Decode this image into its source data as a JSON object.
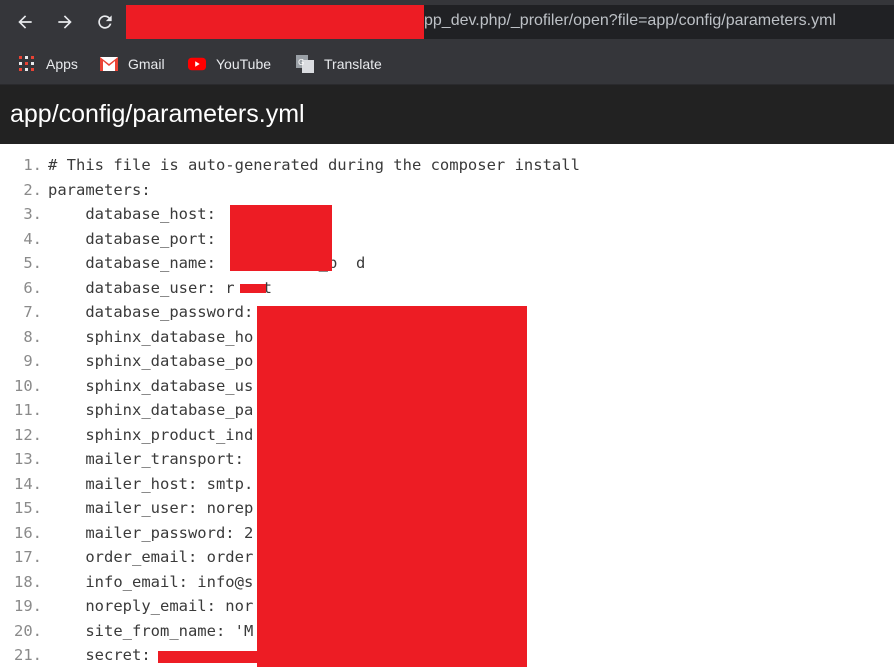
{
  "browser": {
    "url_visible": "pp_dev.php/_profiler/open?file=app/config/parameters.yml",
    "bookmarks": [
      {
        "label": "Apps",
        "icon": "apps-grid-icon"
      },
      {
        "label": "Gmail",
        "icon": "gmail-icon"
      },
      {
        "label": "YouTube",
        "icon": "youtube-icon"
      },
      {
        "label": "Translate",
        "icon": "translate-icon"
      }
    ]
  },
  "page": {
    "title": "app/config/parameters.yml"
  },
  "code_lines": [
    {
      "n": "1.",
      "text": "# This file is auto-generated during the composer install"
    },
    {
      "n": "2.",
      "text": "parameters:"
    },
    {
      "n": "3.",
      "text": "    database_host:"
    },
    {
      "n": "4.",
      "text": "    database_port:"
    },
    {
      "n": "5.",
      "text": "    database_name:           _p  d"
    },
    {
      "n": "6.",
      "text": "    database_user: r   t"
    },
    {
      "n": "7.",
      "text": "    database_password:"
    },
    {
      "n": "8.",
      "text": "    sphinx_database_ho"
    },
    {
      "n": "9.",
      "text": "    sphinx_database_po"
    },
    {
      "n": "10.",
      "text": "    sphinx_database_us"
    },
    {
      "n": "11.",
      "text": "    sphinx_database_pa"
    },
    {
      "n": "12.",
      "text": "    sphinx_product_ind                           ex"
    },
    {
      "n": "13.",
      "text": "    mailer_transport:"
    },
    {
      "n": "14.",
      "text": "    mailer_host: smtp."
    },
    {
      "n": "15.",
      "text": "    mailer_user: norep"
    },
    {
      "n": "16.",
      "text": "    mailer_password: 2"
    },
    {
      "n": "17.",
      "text": "    order_email: order"
    },
    {
      "n": "18.",
      "text": "    info_email: info@s"
    },
    {
      "n": "19.",
      "text": "    noreply_email: nor"
    },
    {
      "n": "20.",
      "text": "    site_from_name: 'M"
    },
    {
      "n": "21.",
      "text": "    secret:"
    }
  ],
  "colors": {
    "redaction": "#ed1c24",
    "chrome": "#35363a",
    "header": "#222222"
  }
}
